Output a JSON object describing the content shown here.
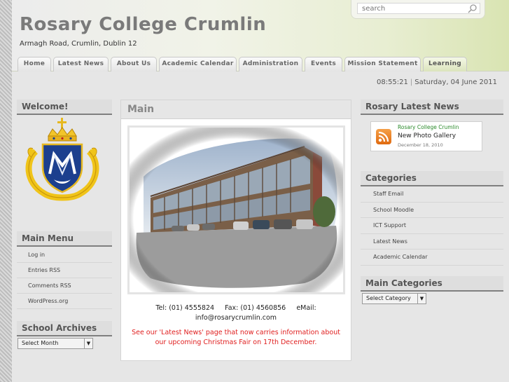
{
  "site": {
    "title": "Rosary College Crumlin",
    "description": "Armagh Road, Crumlin, Dublin 12"
  },
  "search": {
    "placeholder": "search"
  },
  "nav": {
    "tabs": [
      {
        "label": "Home"
      },
      {
        "label": "Latest News"
      },
      {
        "label": "About Us"
      },
      {
        "label": "Academic Calendar"
      },
      {
        "label": "Administration"
      },
      {
        "label": "Events"
      },
      {
        "label": "Mission Statement"
      },
      {
        "label": "Learning"
      }
    ]
  },
  "datetime": {
    "time": "08:55:21",
    "separator": "|",
    "date": "Saturday, 04 June 2011"
  },
  "left": {
    "welcome_title": "Welcome!",
    "main_menu_title": "Main Menu",
    "main_menu": [
      "Log in",
      "Entries RSS",
      "Comments RSS",
      "WordPress.org"
    ],
    "archives_title": "School Archives",
    "archives_select": "Select Month"
  },
  "main": {
    "title": "Main",
    "contact_line1": "Tel: (01) 4555824     Fax: (01) 4560856     eMail:",
    "contact_line2": "info@rosarycrumlin.com",
    "notice_line1": "See our 'Latest News' page that now carries information about",
    "notice_line2": "our upcoming Christmas Fair on 17th December."
  },
  "right": {
    "news_title": "Rosary Latest News",
    "news_source": "Rosary College Crumlin",
    "news_headline": "New Photo Gallery",
    "news_date": "December 18, 2010",
    "categories_title": "Categories",
    "categories": [
      "Staff Email",
      "School Moodle",
      "ICT Support",
      "Latest News",
      "Academic Calendar"
    ],
    "main_categories_title": "Main Categories",
    "main_categories_select": "Select Category"
  },
  "colors": {
    "title_gray": "#7a7a7a",
    "notice_red": "#e02020",
    "rss_orange": "#e8821e",
    "news_source_green": "#2a8a2a",
    "crest_blue": "#1c3f8e",
    "crest_gold": "#f0c419"
  }
}
